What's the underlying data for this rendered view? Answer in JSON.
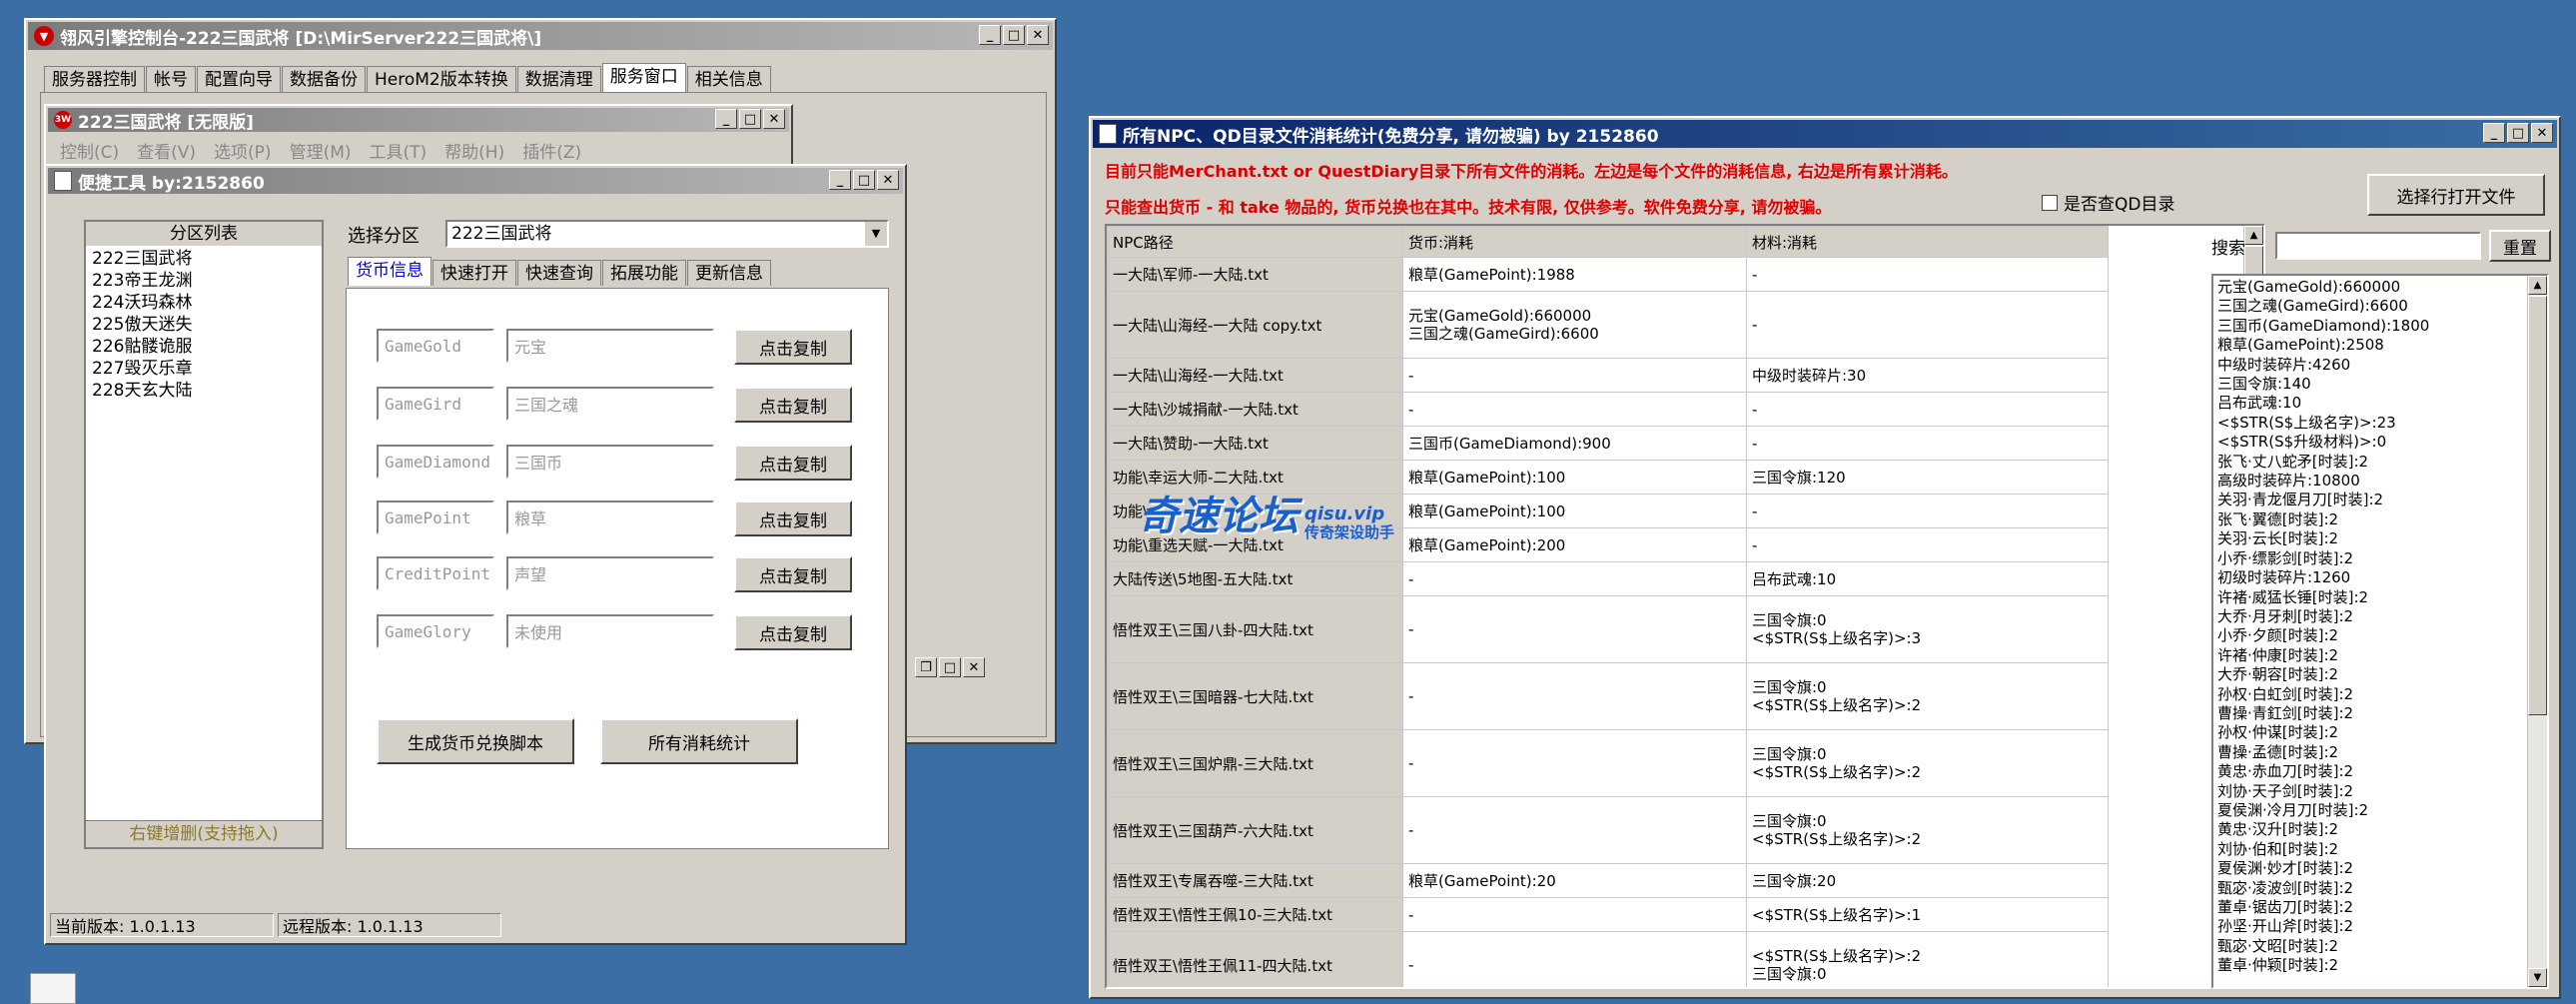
{
  "console_window": {
    "title": "翎风引擎控制台-222三国武将 [D:\\MirServer222三国武将\\]",
    "tabs": [
      "服务器控制",
      "帐号",
      "配置向导",
      "数据备份",
      "HeroM2版本转换",
      "数据清理",
      "服务窗口",
      "相关信息"
    ],
    "selected_tab": "服务窗口"
  },
  "inner_window": {
    "title": "222三国武将 [无限版]",
    "menu": [
      "控制(C)",
      "查看(V)",
      "选项(P)",
      "管理(M)",
      "工具(T)",
      "帮助(H)",
      "插件(Z)"
    ]
  },
  "tool_window": {
    "title": "便捷工具   by:2152860",
    "partition_list": {
      "header": "分区列表",
      "items": [
        "222三国武将",
        "223帝王龙渊",
        "224沃玛森林",
        "225傲天迷失",
        "226骷髅诡服",
        "227毁灭乐章",
        "228天玄大陆"
      ],
      "footer": "右键增删(支持拖入)"
    },
    "select_partition_label": "选择分区",
    "select_partition_value": "222三国武将",
    "tabs": [
      "货币信息",
      "快速打开",
      "快速查询",
      "拓展功能",
      "更新信息"
    ],
    "selected_tab": "货币信息",
    "currencies": [
      {
        "key": "GameGold",
        "name": "元宝"
      },
      {
        "key": "GameGird",
        "name": "三国之魂"
      },
      {
        "key": "GameDiamond",
        "name": "三国币"
      },
      {
        "key": "GamePoint",
        "name": "粮草"
      },
      {
        "key": "CreditPoint",
        "name": "声望"
      },
      {
        "key": "GameGlory",
        "name": "未使用"
      }
    ],
    "copy_button": "点击复制",
    "generate_button": "生成货币兑换脚本",
    "all_stats_button": "所有消耗统计",
    "current_version": "当前版本: 1.0.1.13",
    "remote_version": "远程版本: 1.0.1.13"
  },
  "stats_window": {
    "title": "所有NPC、QD目录文件消耗统计(免费分享, 请勿被骗)     by 2152860",
    "notice_line1": "目前只能MerChant.txt or QuestDiary目录下所有文件的消耗。左边是每个文件的消耗信息, 右边是所有累计消耗。",
    "notice_line2": "只能查出货币 - 和 take 物品的, 货币兑换也在其中。技术有限, 仅供参考。软件免费分享, 请勿被骗。",
    "checkbox_label": "是否查QD目录",
    "open_button": "选择行打开文件",
    "search_label": "搜索",
    "reset_button": "重置",
    "columns": [
      "NPC路径",
      "货币:消耗",
      "材料:消耗"
    ],
    "rows": [
      [
        "一大陆\\军师-一大陆.txt",
        [
          "粮草(GamePoint):1988"
        ],
        [
          "-"
        ]
      ],
      [
        "一大陆\\山海经-一大陆 copy.txt",
        [
          "元宝(GameGold):660000",
          "三国之魂(GameGird):6600"
        ],
        [
          "-"
        ]
      ],
      [
        "一大陆\\山海经-一大陆.txt",
        [
          "-"
        ],
        [
          "中级时装碎片:30"
        ]
      ],
      [
        "一大陆\\沙城捐献-一大陆.txt",
        [
          "-"
        ],
        [
          "-"
        ]
      ],
      [
        "一大陆\\赞助-一大陆.txt",
        [
          "三国币(GameDiamond):900"
        ],
        [
          "-"
        ]
      ],
      [
        "功能\\幸运大师-二大陆.txt",
        [
          "粮草(GamePoint):100"
        ],
        [
          "三国令旗:120"
        ]
      ],
      [
        "功能\\...",
        [
          "粮草(GamePoint):100"
        ],
        [
          "-"
        ]
      ],
      [
        "功能\\重选天赋-一大陆.txt",
        [
          "粮草(GamePoint):200"
        ],
        [
          "-"
        ]
      ],
      [
        "大陆传送\\5地图-五大陆.txt",
        [
          "-"
        ],
        [
          "吕布武魂:10"
        ]
      ],
      [
        "悟性双王\\三国八卦-四大陆.txt",
        [
          "-"
        ],
        [
          "三国令旗:0",
          "<$STR(S$上级名字)>:3"
        ]
      ],
      [
        "悟性双王\\三国暗器-七大陆.txt",
        [
          "-"
        ],
        [
          "三国令旗:0",
          "<$STR(S$上级名字)>:2"
        ]
      ],
      [
        "悟性双王\\三国炉鼎-三大陆.txt",
        [
          "-"
        ],
        [
          "三国令旗:0",
          "<$STR(S$上级名字)>:2"
        ]
      ],
      [
        "悟性双王\\三国葫芦-六大陆.txt",
        [
          "-"
        ],
        [
          "三国令旗:0",
          "<$STR(S$上级名字)>:2"
        ]
      ],
      [
        "悟性双王\\专属吞噬-三大陆.txt",
        [
          "粮草(GamePoint):20"
        ],
        [
          "三国令旗:20"
        ]
      ],
      [
        "悟性双王\\悟性王佩10-三大陆.txt",
        [
          "-"
        ],
        [
          "<$STR(S$上级名字)>:1"
        ]
      ],
      [
        "悟性双王\\悟性王佩11-四大陆.txt",
        [
          "-"
        ],
        [
          "<$STR(S$上级名字)>:2",
          "三国令旗:0"
        ]
      ]
    ],
    "totals": [
      "元宝(GameGold):660000",
      "三国之魂(GameGird):6600",
      "三国币(GameDiamond):1800",
      "粮草(GamePoint):2508",
      "中级时装碎片:4260",
      "三国令旗:140",
      "吕布武魂:10",
      "<$STR(S$上级名字)>:23",
      "<$STR(S$升级材料)>:0",
      "张飞·丈八蛇矛[时装]:2",
      "高级时装碎片:10800",
      "关羽·青龙偃月刀[时装]:2",
      "张飞·翼德[时装]:2",
      "关羽·云长[时装]:2",
      "小乔·缥影剑[时装]:2",
      "初级时装碎片:1260",
      "许褚·威猛长锤[时装]:2",
      "大乔·月牙刺[时装]:2",
      "小乔·夕颜[时装]:2",
      "许褚·仲康[时装]:2",
      "大乔·朝容[时装]:2",
      "孙权·白虹剑[时装]:2",
      "曹操·青釭剑[时装]:2",
      "孙权·仲谋[时装]:2",
      "曹操·孟德[时装]:2",
      "黄忠·赤血刀[时装]:2",
      "刘协·天子剑[时装]:2",
      "夏侯渊·冷月刀[时装]:2",
      "黄忠·汉升[时装]:2",
      "刘协·伯和[时装]:2",
      "夏侯渊·妙才[时装]:2",
      "甄宓·凌波剑[时装]:2",
      "董卓·锯齿刀[时装]:2",
      "孙坚·开山斧[时装]:2",
      "甄宓·文昭[时装]:2",
      "董卓·仲颖[时装]:2"
    ]
  },
  "watermark": {
    "main": "奇速论坛",
    "domain": "qisu.vip",
    "sub": "传奇架设助手"
  }
}
